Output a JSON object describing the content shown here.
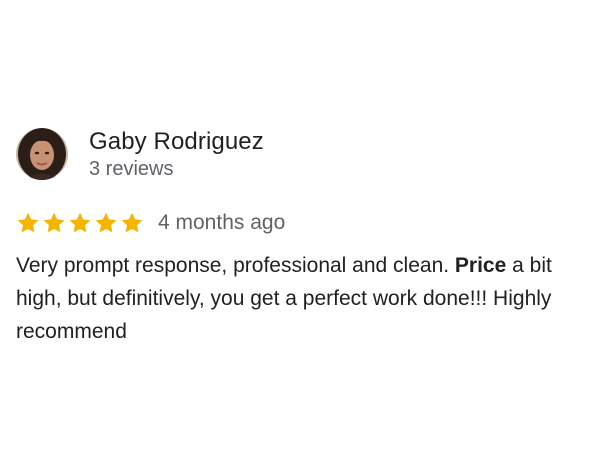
{
  "review": {
    "author_name": "Gaby Rodriguez",
    "author_meta": "3 reviews",
    "rating": 5,
    "rating_max": 5,
    "star_color": "#f4b400",
    "date": "4 months ago",
    "text_part1": "Very prompt response, professional and clean. ",
    "text_bold": "Price",
    "text_part2": " a bit high, but definitively, you get a perfect work done!!! Highly recommend"
  }
}
